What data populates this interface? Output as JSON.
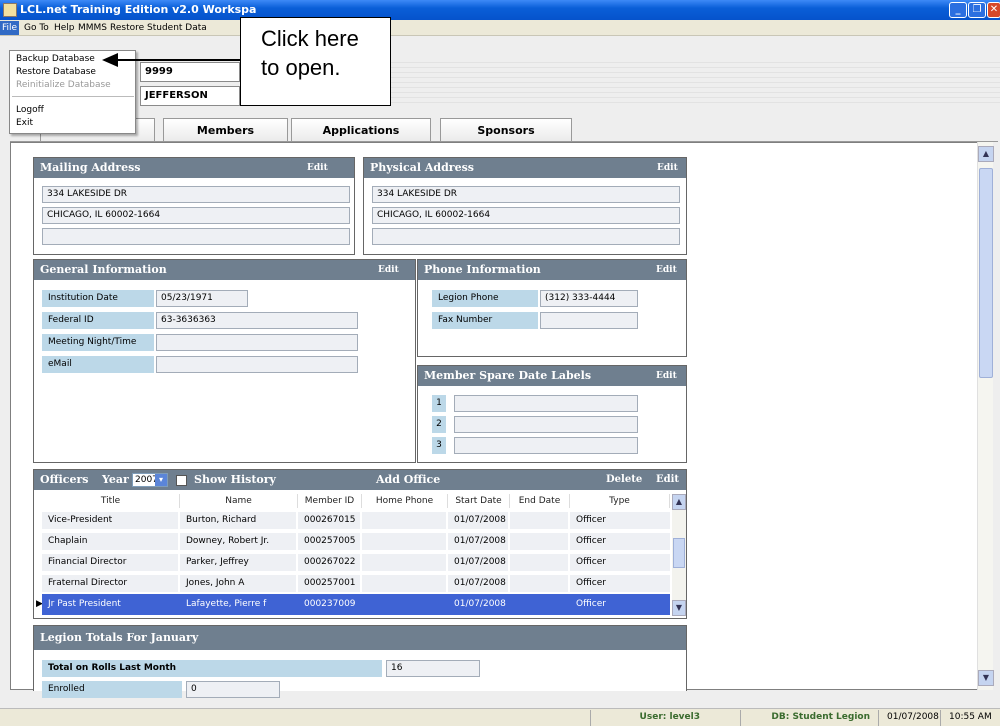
{
  "window": {
    "title": "LCL.net Training Edition v2.0 Workspa"
  },
  "menubar": {
    "items": [
      "File",
      "Go To",
      "Help",
      "MMMS",
      "Restore Student Data"
    ]
  },
  "file_menu": {
    "items": [
      "Backup Database",
      "Restore Database",
      "Reinitialize Database",
      "Logoff",
      "Exit"
    ]
  },
  "callout": {
    "line1": "Click here",
    "line2": "to open."
  },
  "header": {
    "legion_number": "9999",
    "legion_name": "JEFFERSON"
  },
  "tabs": [
    "Members",
    "Applications",
    "Sponsors"
  ],
  "mailing": {
    "title": "Mailing Address",
    "edit": "Edit",
    "line1": "334 LAKESIDE DR",
    "line2": "CHICAGO, IL 60002-1664",
    "line3": ""
  },
  "physical": {
    "title": "Physical Address",
    "edit": "Edit",
    "line1": "334 LAKESIDE DR",
    "line2": "CHICAGO, IL 60002-1664",
    "line3": ""
  },
  "general": {
    "title": "General Information",
    "edit": "Edit",
    "fields": [
      {
        "label": "Institution Date",
        "value": "05/23/1971"
      },
      {
        "label": "Federal ID",
        "value": "63-3636363"
      },
      {
        "label": "Meeting Night/Time",
        "value": ""
      },
      {
        "label": "eMail",
        "value": ""
      }
    ]
  },
  "phone": {
    "title": "Phone Information",
    "edit": "Edit",
    "fields": [
      {
        "label": "Legion Phone",
        "value": "(312) 333-4444"
      },
      {
        "label": "Fax Number",
        "value": ""
      }
    ]
  },
  "spare": {
    "title": "Member Spare Date Labels",
    "edit": "Edit",
    "labels": [
      "1",
      "2",
      "3"
    ]
  },
  "officers": {
    "title": "Officers",
    "year_label": "Year",
    "year": "2007",
    "show_history": "Show History",
    "add_office": "Add Office",
    "delete": "Delete",
    "edit": "Edit",
    "columns": [
      "Title",
      "Name",
      "Member ID",
      "Home Phone",
      "Start Date",
      "End Date",
      "Type"
    ],
    "rows": [
      {
        "title": "Vice-President",
        "name": "Burton, Richard",
        "id": "000267015",
        "phone": "",
        "start": "01/07/2008",
        "end": "",
        "type": "Officer"
      },
      {
        "title": "Chaplain",
        "name": "Downey, Robert Jr.",
        "id": "000257005",
        "phone": "",
        "start": "01/07/2008",
        "end": "",
        "type": "Officer"
      },
      {
        "title": "Financial Director",
        "name": "Parker, Jeffrey",
        "id": "000267022",
        "phone": "",
        "start": "01/07/2008",
        "end": "",
        "type": "Officer"
      },
      {
        "title": "Fraternal Director",
        "name": "Jones, John A",
        "id": "000257001",
        "phone": "",
        "start": "01/07/2008",
        "end": "",
        "type": "Officer"
      },
      {
        "title": "Jr Past President",
        "name": "Lafayette, Pierre f",
        "id": "000237009",
        "phone": "",
        "start": "01/07/2008",
        "end": "",
        "type": "Officer"
      }
    ]
  },
  "totals": {
    "title": "Legion Totals For January",
    "rows": [
      {
        "label": "Total on Rolls Last Month",
        "value": "16"
      },
      {
        "label": "Enrolled",
        "value": "0"
      }
    ]
  },
  "status": {
    "user": "User: level3",
    "db": "DB: Student Legion",
    "date": "01/07/2008",
    "time": "10:55 AM"
  }
}
